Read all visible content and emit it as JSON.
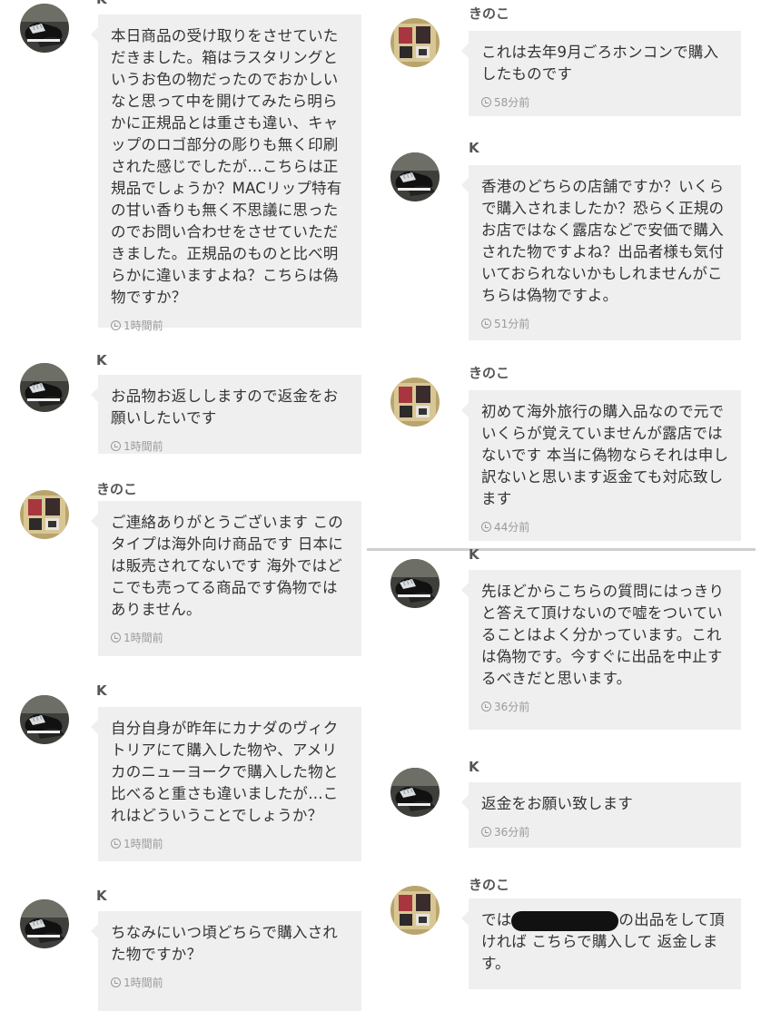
{
  "left": [
    {
      "name": "K",
      "avatar": "shoes",
      "text": "本日商品の受け取りをさせていただきました。箱はラスタリングというお色の物だったのでおかしいなと思って中を開けてみたら明らかに正規品とは重さも違い、キャップのロゴ部分の彫りも無く印刷された感じでしたが…こちらは正規品でしょうか？MACリップ特有の甘い香りも無く不思議に思ったのでお問い合わせをさせていただきました。正規品のものと比べ明らかに違いますよね？こちらは偽物ですか？",
      "time": "1時間前"
    },
    {
      "name": "K",
      "avatar": "shoes",
      "text": "お品物お返ししますので返金をお願いしたいです",
      "time": "1時間前"
    },
    {
      "name": "きのこ",
      "avatar": "cards",
      "text": "ご連絡ありがとうございます このタイプは海外向け商品です 日本には販売されてないです 海外ではどこでも売ってる商品です偽物ではありません。",
      "time": "1時間前"
    },
    {
      "name": "K",
      "avatar": "shoes",
      "text": "自分自身が昨年にカナダのヴィクトリアにて購入した物や、アメリカのニューヨークで購入した物と比べると重さも違いましたが…これはどういうことでしょうか？",
      "time": "1時間前"
    },
    {
      "name": "K",
      "avatar": "shoes",
      "text": "ちなみにいつ頃どちらで購入された物ですか？",
      "time": "1時間前"
    }
  ],
  "right": [
    {
      "name": "きのこ",
      "avatar": "cards",
      "text": "これは去年9月ごろホンコンで購入したものです",
      "time": "58分前"
    },
    {
      "name": "K",
      "avatar": "shoes",
      "text": "香港のどちらの店舗ですか？いくらで購入されましたか？恐らく正規のお店ではなく露店などで安価で購入された物ですよね？出品者様も気付いておられないかもしれませんがこちらは偽物ですよ。",
      "time": "51分前"
    },
    {
      "name": "きのこ",
      "avatar": "cards",
      "text": "初めて海外旅行の購入品なので元でいくらが覚えていませんが露店ではないです 本当に偽物ならそれは申し訳ないと思います返金ても対応致します",
      "time": "44分前"
    },
    {
      "name": "K",
      "avatar": "shoes",
      "text": "先ほどからこちらの質問にはっきりと答えて頂けないので嘘をついていることはよく分かっています。これは偽物です。今すぐに出品を中止するべきだと思います。",
      "time": "36分前"
    },
    {
      "name": "K",
      "avatar": "shoes",
      "text": "返金をお願い致します",
      "time": "36分前"
    },
    {
      "name": "きのこ",
      "avatar": "cards",
      "text_before": "では",
      "text_after": "の出品をして頂ければ こちらで購入して 返金します。",
      "time": ""
    }
  ],
  "colors": {
    "bubble": "#efefef",
    "time": "#9a9a9a",
    "text": "#333333"
  }
}
